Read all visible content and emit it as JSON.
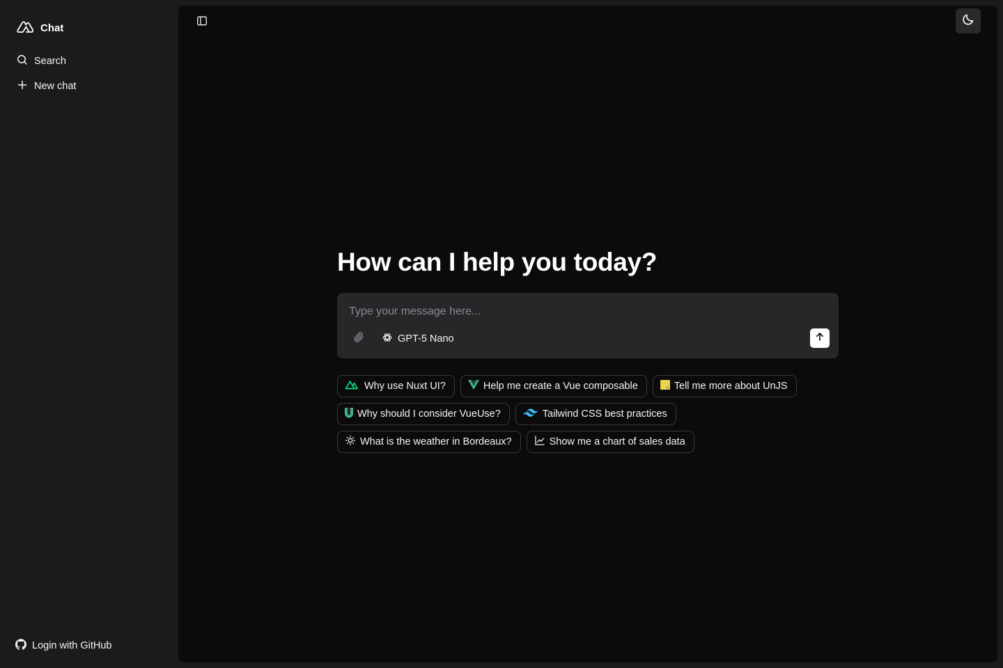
{
  "sidebar": {
    "brand": {
      "title": "Chat",
      "icon": "nuxt-logo-icon"
    },
    "nav": [
      {
        "label": "Search",
        "icon": "search-icon"
      },
      {
        "label": "New chat",
        "icon": "plus-icon"
      }
    ],
    "login": {
      "label": "Login with GitHub",
      "icon": "github-icon"
    }
  },
  "main": {
    "hero_title": "How can I help you today?",
    "composer": {
      "placeholder": "Type your message here...",
      "value": "",
      "model": "GPT-5 Nano",
      "model_icon": "openai-icon",
      "attach_icon": "paperclip-icon",
      "send_icon": "arrow-up-icon"
    },
    "suggestions": [
      {
        "label": "Why use Nuxt UI?",
        "icon": "nuxt-icon"
      },
      {
        "label": "Help me create a Vue composable",
        "icon": "vue-icon"
      },
      {
        "label": "Tell me more about UnJS",
        "icon": "unjs-icon"
      },
      {
        "label": "Why should I consider VueUse?",
        "icon": "vueuse-icon"
      },
      {
        "label": "Tailwind CSS best practices",
        "icon": "tailwind-icon"
      },
      {
        "label": "What is the weather in Bordeaux?",
        "icon": "sun-icon"
      },
      {
        "label": "Show me a chart of sales data",
        "icon": "line-chart-icon"
      }
    ]
  },
  "colors": {
    "sidebar_bg": "#1b1b1d",
    "main_bg": "#0b0b0c",
    "composer_bg": "#27272a",
    "nuxt_green": "#00dc82",
    "vue_green": "#41b883",
    "unjs_yellow": "#e8d44d",
    "tailwind_cyan": "#38bdf8"
  }
}
